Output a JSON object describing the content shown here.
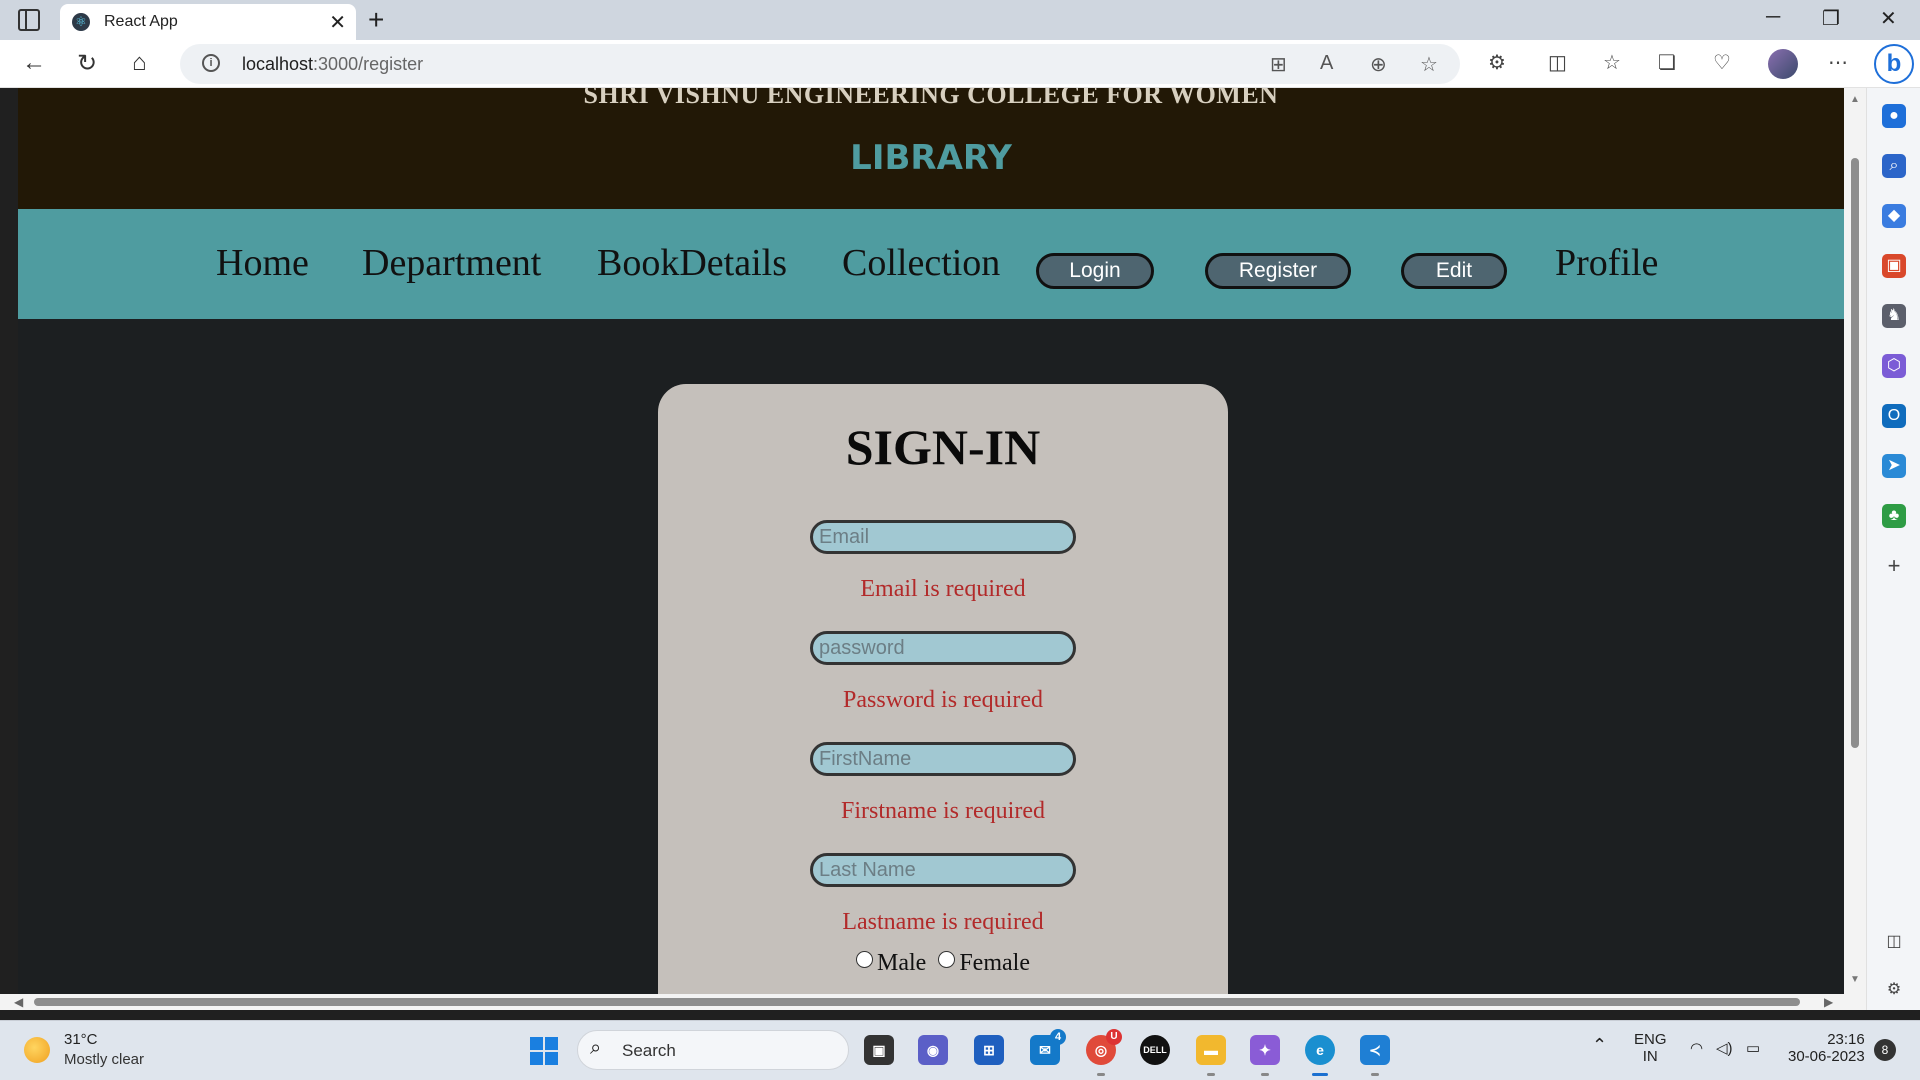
{
  "browser": {
    "tab_title": "React App",
    "tab_close": "✕",
    "new_tab": "+",
    "url_host": "localhost",
    "url_path": ":3000/register",
    "win_min": "─",
    "win_restore": "❐",
    "win_close": "✕"
  },
  "site": {
    "college": "SHRI VISHNU ENGINEERING COLLEGE FOR WOMEN",
    "library": "LIBRARY"
  },
  "nav": {
    "home": "Home",
    "department": "Department",
    "bookdetails": "BookDetails",
    "collection": "Collection",
    "login": "Login",
    "register": "Register",
    "edit": "Edit",
    "profile": "Profile"
  },
  "form": {
    "title": "SIGN-IN",
    "email_placeholder": "Email",
    "email_error": "Email is required",
    "password_placeholder": "password",
    "password_error": "Password is required",
    "firstname_placeholder": "FirstName",
    "firstname_error": "Firstname is required",
    "lastname_placeholder": "Last Name",
    "lastname_error": "Lastname is required",
    "gender_male": "Male",
    "gender_female": "Female"
  },
  "taskbar": {
    "temperature": "31°C",
    "weather": "Mostly clear",
    "search": "Search",
    "lang_top": "ENG",
    "lang_bottom": "IN",
    "time": "23:16",
    "date": "30-06-2023",
    "notifications": "8",
    "mail_badge": "4",
    "chrome_badge": "U"
  },
  "colors": {
    "header_bg": "#221806",
    "nav_bg": "#4f9ca0",
    "page_bg": "#1c1f21",
    "card_bg": "#c5c0bb",
    "error": "#b22a2a",
    "input_bg": "#a1c8d2"
  }
}
